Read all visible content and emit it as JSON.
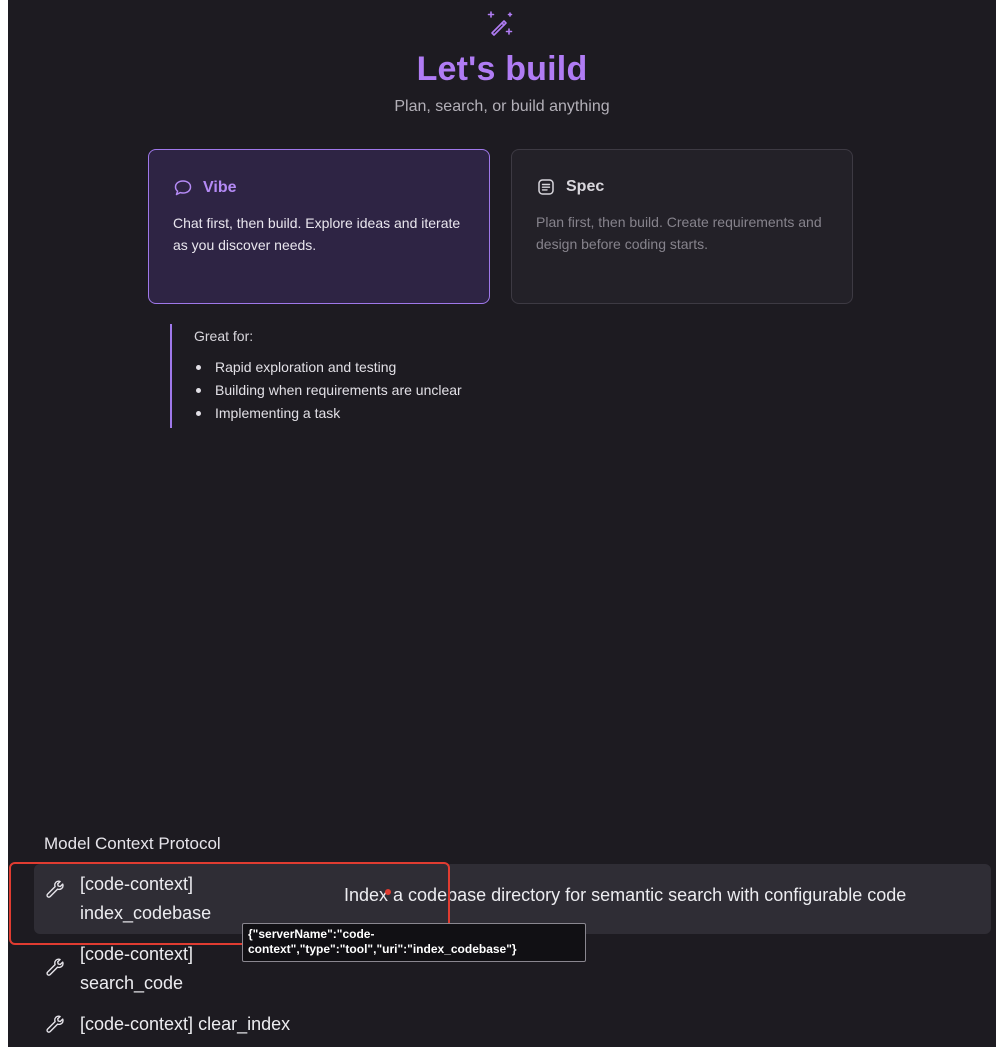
{
  "header": {
    "icon": "magic-wand-sparkle-icon",
    "title": "Let's build",
    "subtitle": "Plan, search, or build anything"
  },
  "modes": [
    {
      "id": "vibe",
      "icon": "chat-bubble-icon",
      "title": "Vibe",
      "description": "Chat first, then build. Explore ideas and iterate as you discover needs.",
      "selected": true
    },
    {
      "id": "spec",
      "icon": "document-lines-icon",
      "title": "Spec",
      "description": "Plan first, then build. Create requirements and design before coding starts.",
      "selected": false
    }
  ],
  "great_for": {
    "label": "Great for:",
    "items": [
      "Rapid exploration and testing",
      "Building when requirements are unclear",
      "Implementing a task"
    ]
  },
  "mcp": {
    "heading": "Model Context Protocol",
    "items": [
      {
        "icon": "wrench-icon",
        "label_line1": "[code-context]",
        "label_line2": "index_codebase",
        "description": "Index a codebase directory for semantic search with configurable code",
        "highlighted": true
      },
      {
        "icon": "wrench-icon",
        "label_line1": "[code-context]",
        "label_line2": "search_code"
      },
      {
        "icon": "wrench-icon",
        "label_line1": "[code-context] clear_index"
      }
    ],
    "tooltip": "{\"serverName\":\"code-context\",\"type\":\"tool\",\"uri\":\"index_codebase\"}"
  },
  "colors": {
    "panel_bg": "#1d1b21",
    "accent_purple": "#b07cf4",
    "selected_card_bg": "#2e2444",
    "selected_card_border": "#9f78ea",
    "annotation_red": "#e03c31"
  }
}
